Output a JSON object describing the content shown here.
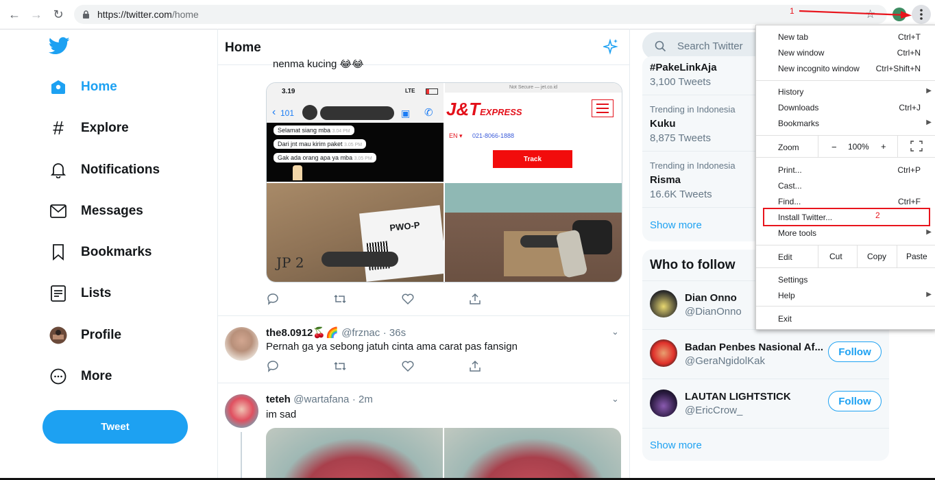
{
  "browser": {
    "url_host": "https://twitter.com",
    "url_path": "/home",
    "annotation_1": "1",
    "annotation_2": "2"
  },
  "sidebar": {
    "items": [
      {
        "label": "Home"
      },
      {
        "label": "Explore"
      },
      {
        "label": "Notifications"
      },
      {
        "label": "Messages"
      },
      {
        "label": "Bookmarks"
      },
      {
        "label": "Lists"
      },
      {
        "label": "Profile"
      },
      {
        "label": "More"
      }
    ],
    "tweet_label": "Tweet"
  },
  "main": {
    "title": "Home",
    "partial_tweet_text": "nenma kucing 😂😂",
    "chat_image": {
      "time": "3.19",
      "network": "LTE",
      "back_count": "101",
      "messages": [
        "Selamat siang mba",
        "Dari jnt mau kirim paket",
        "Gak ada orang apa ya mba"
      ],
      "msg_times": [
        "3.04 PM",
        "3.05 PM",
        "3.05 PM"
      ]
    },
    "jnt_image": {
      "url_bar": "Not Secure — jet.co.id",
      "brand": "J&T",
      "brand_word": "EXPRESS",
      "lang": "EN ▾",
      "phone": "021-8066-1888",
      "track": "Track"
    },
    "box_image": {
      "label1": "PWO-P",
      "label2": "JP 2"
    },
    "tweets": [
      {
        "name": "the8.0912🍒🌈",
        "handle": "@frznac",
        "time": "· 36s",
        "text": "Pernah ga ya sebong jatuh cinta ama carat pas fansign"
      },
      {
        "name": "teteh",
        "handle": "@wartafana",
        "time": "· 2m",
        "text": "im sad"
      }
    ]
  },
  "right": {
    "search_placeholder": "Search Twitter",
    "trends": [
      {
        "sub": "",
        "title": "#PakeLinkAja",
        "count": "3,100 Tweets"
      },
      {
        "sub": "Trending in Indonesia",
        "title": "Kuku",
        "count": "8,875 Tweets"
      },
      {
        "sub": "Trending in Indonesia",
        "title": "Risma",
        "count": "16.6K Tweets"
      }
    ],
    "show_more": "Show more",
    "who_to_follow": "Who to follow",
    "follow": [
      {
        "name": "Dian Onno",
        "handle": "@DianOnno"
      },
      {
        "name": "Badan Penbes Nasional Af...",
        "handle": "@GeraNgidolKak",
        "btn": "Follow"
      },
      {
        "name": "LAUTAN LIGHTSTICK",
        "handle": "@EricCrow_",
        "btn": "Follow"
      }
    ],
    "show_more2": "Show more"
  },
  "menu": {
    "new_tab": "New tab",
    "new_tab_k": "Ctrl+T",
    "new_window": "New window",
    "new_window_k": "Ctrl+N",
    "incognito": "New incognito window",
    "incognito_k": "Ctrl+Shift+N",
    "history": "History",
    "downloads": "Downloads",
    "downloads_k": "Ctrl+J",
    "bookmarks": "Bookmarks",
    "zoom": "Zoom",
    "zoom_minus": "−",
    "zoom_val": "100%",
    "zoom_plus": "+",
    "print": "Print...",
    "print_k": "Ctrl+P",
    "cast": "Cast...",
    "find": "Find...",
    "find_k": "Ctrl+F",
    "install": "Install Twitter...",
    "more_tools": "More tools",
    "edit": "Edit",
    "cut": "Cut",
    "copy": "Copy",
    "paste": "Paste",
    "settings": "Settings",
    "help": "Help",
    "exit": "Exit"
  },
  "colors": {
    "twitter_blue": "#1da1f2",
    "annotation_red": "#e8141c"
  }
}
